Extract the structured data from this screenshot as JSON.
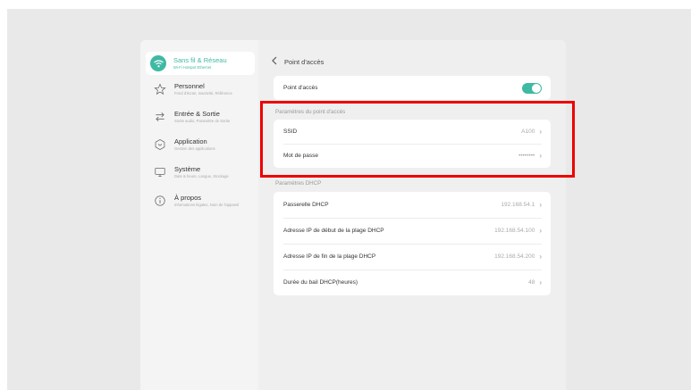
{
  "sidebar": {
    "items": [
      {
        "title": "Sans fil & Réseau",
        "sub": "Wi-Fi Hotspot Ethernet",
        "icon": "wifi-icon",
        "active": true
      },
      {
        "title": "Personnel",
        "sub": "Fond d'écran, Inactivité, Référence",
        "icon": "star-icon"
      },
      {
        "title": "Entrée & Sortie",
        "sub": "Sortie audio, Paramètre de Sortie",
        "icon": "swap-arrows-icon"
      },
      {
        "title": "Application",
        "sub": "Gestion des applications",
        "icon": "app-icon"
      },
      {
        "title": "Système",
        "sub": "Date & heure, Langue, Stockage",
        "icon": "monitor-icon"
      },
      {
        "title": "À propos",
        "sub": "Informations légales, Nom de l'appareil",
        "icon": "info-icon"
      }
    ]
  },
  "header": {
    "back_icon": "chevron-left-icon",
    "title": "Point d'accès"
  },
  "hotspot": {
    "label": "Point d'accès",
    "enabled": true,
    "accent": "#3fb9a3"
  },
  "hotspot_params": {
    "section_title": "Paramètres du point d'accès",
    "rows": [
      {
        "label": "SSID",
        "value": "A100"
      },
      {
        "label": "Mot de passe",
        "value": "••••••••"
      }
    ]
  },
  "dhcp_params": {
    "section_title": "Paramètres DHCP",
    "rows": [
      {
        "label": "Passerelle DHCP",
        "value": "192.168.54.1"
      },
      {
        "label": "Adresse IP de début de la plage DHCP",
        "value": "192.168.54.100"
      },
      {
        "label": "Adresse IP de fin de la plage DHCP",
        "value": "192.168.54.200"
      },
      {
        "label": "Durée du bail DHCP(heures)",
        "value": "48"
      }
    ]
  },
  "chevron_glyph": "›",
  "highlight_color": "#ee0000"
}
